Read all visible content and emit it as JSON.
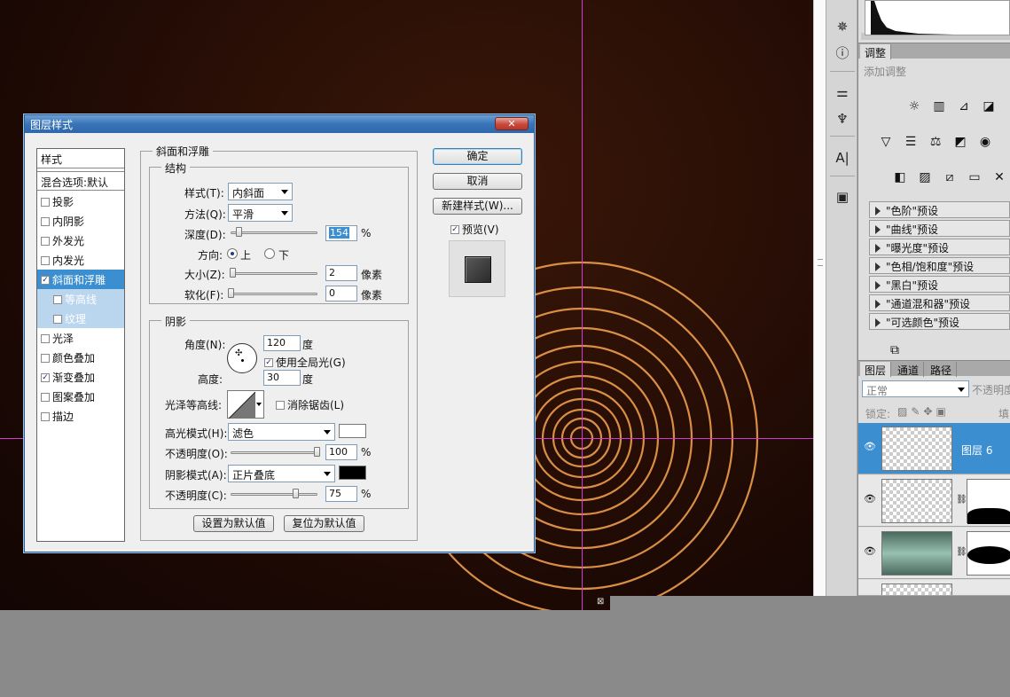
{
  "dialog": {
    "title": "图层样式",
    "close": "✕",
    "style_list": {
      "header": "样式",
      "blend": "混合选项:默认",
      "items": [
        {
          "label": "投影",
          "checked": false
        },
        {
          "label": "内阴影",
          "checked": false
        },
        {
          "label": "外发光",
          "checked": false
        },
        {
          "label": "内发光",
          "checked": false
        },
        {
          "label": "斜面和浮雕",
          "checked": true
        },
        {
          "label": "等高线",
          "checked": false
        },
        {
          "label": "纹理",
          "checked": false
        },
        {
          "label": "光泽",
          "checked": false
        },
        {
          "label": "颜色叠加",
          "checked": false
        },
        {
          "label": "渐变叠加",
          "checked": true
        },
        {
          "label": "图案叠加",
          "checked": false
        },
        {
          "label": "描边",
          "checked": false
        }
      ]
    },
    "bevel": {
      "section_title": "斜面和浮雕",
      "structure_title": "结构",
      "style_label": "样式(T):",
      "style_value": "内斜面",
      "technique_label": "方法(Q):",
      "technique_value": "平滑",
      "depth_label": "深度(D):",
      "depth_value": "154",
      "depth_unit": "%",
      "depth_level_pct": 9,
      "direction_label": "方向:",
      "dir_up": "上",
      "dir_down": "下",
      "size_label": "大小(Z):",
      "size_value": "2",
      "size_unit": "像素",
      "soften_label": "软化(F):",
      "soften_value": "0",
      "soften_unit": "像素"
    },
    "shading": {
      "section_title": "阴影",
      "angle_label": "角度(N):",
      "angle_value": "120",
      "angle_unit": "度",
      "global_light": "使用全局光(G)",
      "altitude_label": "高度:",
      "altitude_value": "30",
      "altitude_unit": "度",
      "gloss_label": "光泽等高线:",
      "antialias": "消除锯齿(L)",
      "highlight_mode_label": "高光模式(H):",
      "highlight_mode": "滤色",
      "highlight_opacity_label": "不透明度(O):",
      "highlight_opacity": "100",
      "shadow_mode_label": "阴影模式(A):",
      "shadow_mode": "正片叠底",
      "shadow_opacity_label": "不透明度(C):",
      "shadow_opacity": "75",
      "pct": "%",
      "highlight_color": "#ffffff",
      "shadow_color": "#000000"
    },
    "make_default": "设置为默认值",
    "reset_default": "复位为默认值",
    "ok": "确定",
    "cancel": "取消",
    "new_style": "新建样式(W)...",
    "preview": "预览(V)"
  },
  "panels": {
    "adjust_tab": "调整",
    "add_adjust": "添加调整",
    "presets": [
      "\"色阶\"预设",
      "\"曲线\"预设",
      "\"曝光度\"预设",
      "\"色相/饱和度\"预设",
      "\"黑白\"预设",
      "\"通道混和器\"预设",
      "\"可选颜色\"预设"
    ],
    "layers_tabs": [
      "图层",
      "通道",
      "路径"
    ],
    "blend_mode": "正常",
    "opacity_label": "不透明度",
    "lock_label": "锁定:",
    "fill_label": "填",
    "layer_active": "图层 6"
  },
  "colors": {
    "accent": "#3b8ed0",
    "guide": "#d23ad0",
    "ring": "#e89a4a"
  }
}
